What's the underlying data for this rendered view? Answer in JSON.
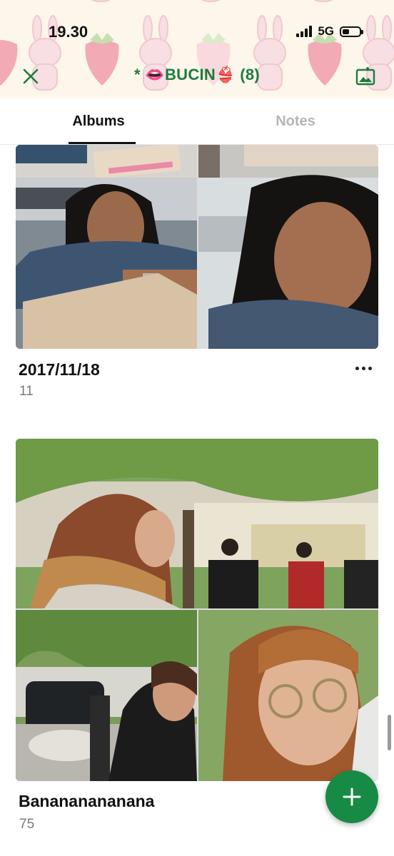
{
  "status_bar": {
    "time": "19.30",
    "network": "5G",
    "battery_level": 0.4
  },
  "header": {
    "title": "* 👄BUCIN👙 (8)",
    "close_icon": "close-icon",
    "album_icon": "album-image-icon",
    "accent_color": "#1b7d3e"
  },
  "tabs": [
    {
      "label": "Albums",
      "active": true
    },
    {
      "label": "Notes",
      "active": false
    }
  ],
  "albums": [
    {
      "title": "2017/11/18",
      "count": "11"
    },
    {
      "title": "Banananananana",
      "count": "75"
    }
  ],
  "fab": {
    "icon": "plus-icon",
    "color": "#178a46"
  }
}
